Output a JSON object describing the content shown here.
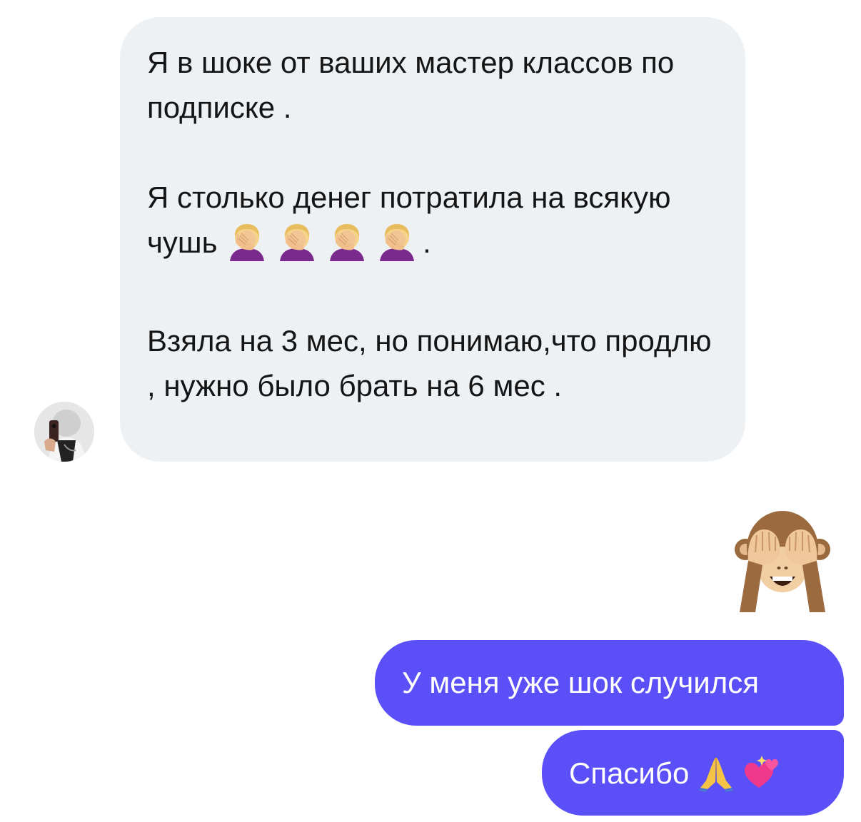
{
  "incoming_message": {
    "paragraph_1": "Я в шоке от ваших мастер классов по подписке .",
    "paragraph_2_text": "Я столько денег потратила на всякую чушь",
    "paragraph_2_end": ".",
    "paragraph_2_emoji": "woman-facepalming-icon",
    "paragraph_2_emoji_count": 4,
    "paragraph_3": "Взяла на 3 мес, но понимаю,что продлю , нужно было брать на 6 мес ."
  },
  "reaction_emoji": "see-no-evil-monkey-icon",
  "outgoing_messages": {
    "message_1": "У меня уже шок случился",
    "message_2": "Спасибо"
  },
  "message_2_emojis": [
    "folded-hands-icon",
    "two-hearts-icon"
  ],
  "colors": {
    "incoming_bubble": "#eef1f4",
    "outgoing_bubble": "#5b50f7",
    "incoming_text": "#151515",
    "outgoing_text": "#ffffff"
  }
}
